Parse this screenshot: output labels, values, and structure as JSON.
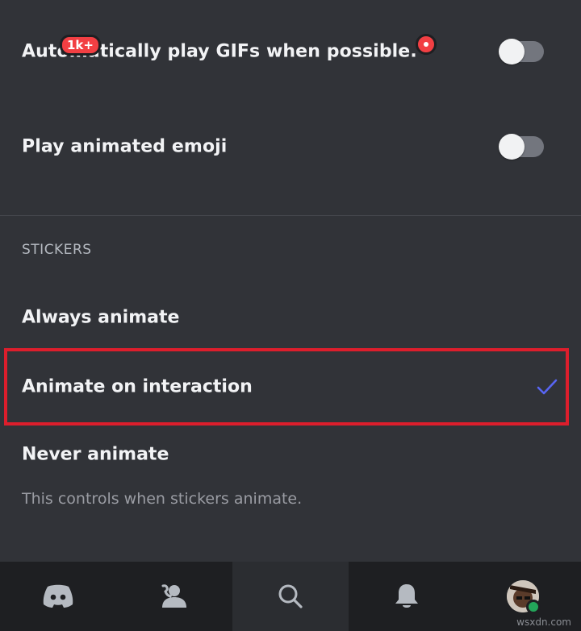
{
  "settings": {
    "gifs_label": "Automatically play GIFs when possible.",
    "gifs_enabled": false,
    "emoji_label": "Play animated emoji",
    "emoji_enabled": false,
    "stickers_header": "STICKERS",
    "options": [
      {
        "label": "Always animate",
        "selected": false
      },
      {
        "label": "Animate on interaction",
        "selected": true
      },
      {
        "label": "Never animate",
        "selected": false
      }
    ],
    "helper_text": "This controls when stickers animate."
  },
  "navbar": {
    "items": [
      {
        "icon": "discord-home-icon",
        "badge": "1k+"
      },
      {
        "icon": "friends-icon"
      },
      {
        "icon": "search-icon",
        "active": true
      },
      {
        "icon": "notifications-bell-icon",
        "badge_dot": true
      },
      {
        "icon": "avatar",
        "status": "online"
      }
    ]
  },
  "watermark": "wsxdn.com",
  "colors": {
    "background": "#313338",
    "navbar": "#1e1f22",
    "accent_check": "#5865f2",
    "highlight_border": "#dd1e2c",
    "badge": "#f23f43",
    "online": "#23a55a"
  }
}
